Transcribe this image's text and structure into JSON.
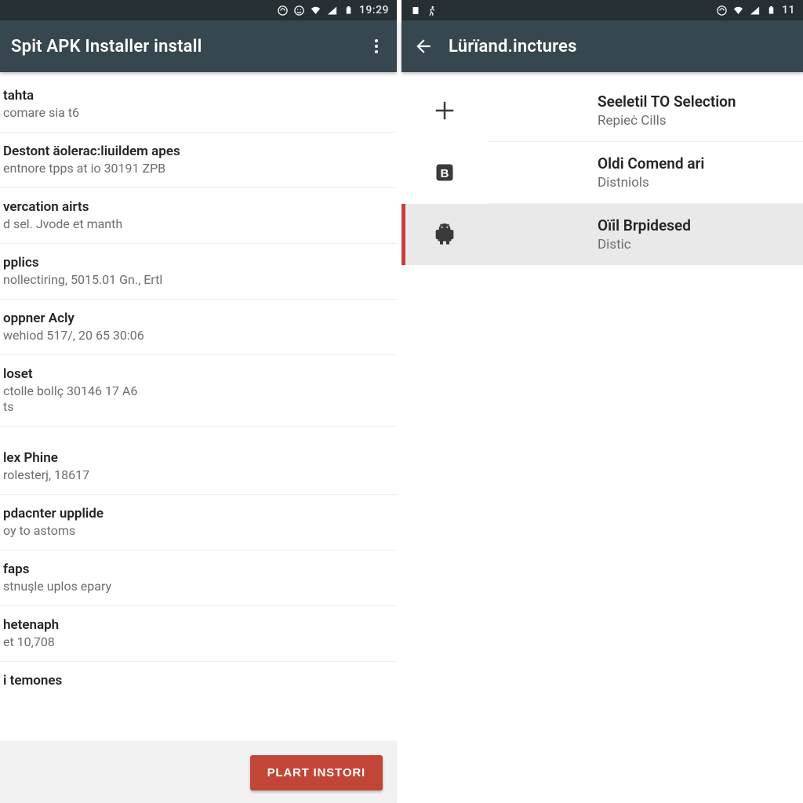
{
  "left": {
    "status": {
      "time": "19:29"
    },
    "appbar": {
      "title": "Spit APK Installer install"
    },
    "rows": [
      {
        "title": "tahta",
        "sub": "comare sia t6"
      },
      {
        "title": "Destont äolerac:liuildem apes",
        "sub": "entnore tрps at io 30191 ZPB"
      },
      {
        "title": "vercation airts",
        "sub": "d sel. Jvode et manth"
      },
      {
        "title": "pplics",
        "sub": "nollectiring, 5015.01 Gn., Ertl"
      },
      {
        "title": "opрner Acly",
        "sub": "wehiod 517/, 20 65 30:06"
      },
      {
        "title": "loset",
        "sub": "ctolle bollç 30146 17 A6\nts"
      },
      {
        "title": "lex Phine",
        "sub": "rolesterj, 18617"
      },
      {
        "title": "pdacnter upplide",
        "sub": "oy to astoms"
      },
      {
        "title": "faps",
        "sub": "stnuşle uplos epary"
      },
      {
        "title": "hetenaph",
        "sub": "et 10,708"
      },
      {
        "title": "i temones",
        "sub": ""
      }
    ],
    "install_label": "PLART INSTОRI"
  },
  "right": {
    "status": {
      "time": "11"
    },
    "appbar": {
      "title": "Lürïand.inctures"
    },
    "rows": [
      {
        "icon": "plus",
        "title": "Seeletil TO Selection",
        "sub": "Repieċ Cills",
        "selected": false
      },
      {
        "icon": "b-square",
        "title": "Oldi Comend ari",
        "sub": "Distniols",
        "selected": false
      },
      {
        "icon": "android",
        "title": "Oïil Brpidesed",
        "sub": "Distic",
        "selected": true
      }
    ]
  }
}
